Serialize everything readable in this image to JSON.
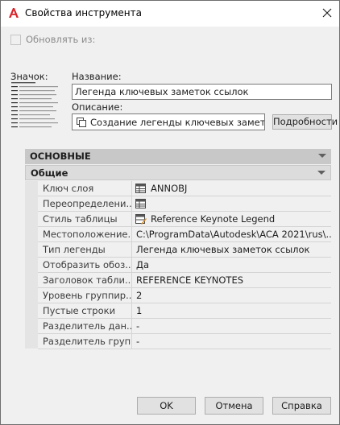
{
  "window": {
    "title": "Свойства инструмента"
  },
  "update_from": {
    "label": "Обновлять из:"
  },
  "icon_section": {
    "label": "Значок:"
  },
  "name_field": {
    "label": "Название:",
    "value": "Легенда ключевых заметок ссылок"
  },
  "description": {
    "label": "Описание:",
    "value": "Создание легенды ключевых заметок с",
    "details_button": "Подробности"
  },
  "property_grid": {
    "category_main": "ОСНОВНЫЕ",
    "category_sub": "Общие",
    "rows": [
      {
        "name": "Ключ слоя",
        "value": "ANNOBJ",
        "icon": "table-icon"
      },
      {
        "name": "Переопределени...",
        "value": "",
        "icon": "table-icon"
      },
      {
        "name": "Стиль таблицы",
        "value": "Reference Keynote Legend",
        "icon": "table-style-icon"
      },
      {
        "name": "Местоположение...",
        "value": "C:\\ProgramData\\Autodesk\\ACA  2021\\rus\\..."
      },
      {
        "name": "Тип легенды",
        "value": "Легенда ключевых заметок ссылок"
      },
      {
        "name": "Отобразить  обоз...",
        "value": "Да"
      },
      {
        "name": "Заголовок  табли...",
        "value": "REFERENCE KEYNOTES"
      },
      {
        "name": "Уровень  группир...",
        "value": "2"
      },
      {
        "name": "Пустые строки",
        "value": "1"
      },
      {
        "name": "Разделитель  дан...",
        "value": "-"
      },
      {
        "name": "Разделитель групп",
        "value": "-"
      }
    ]
  },
  "buttons": {
    "ok": "OK",
    "cancel": "Отмена",
    "help": "Справка"
  },
  "colors": {
    "accent": "#d8262d",
    "background": "#f0f0f0"
  }
}
